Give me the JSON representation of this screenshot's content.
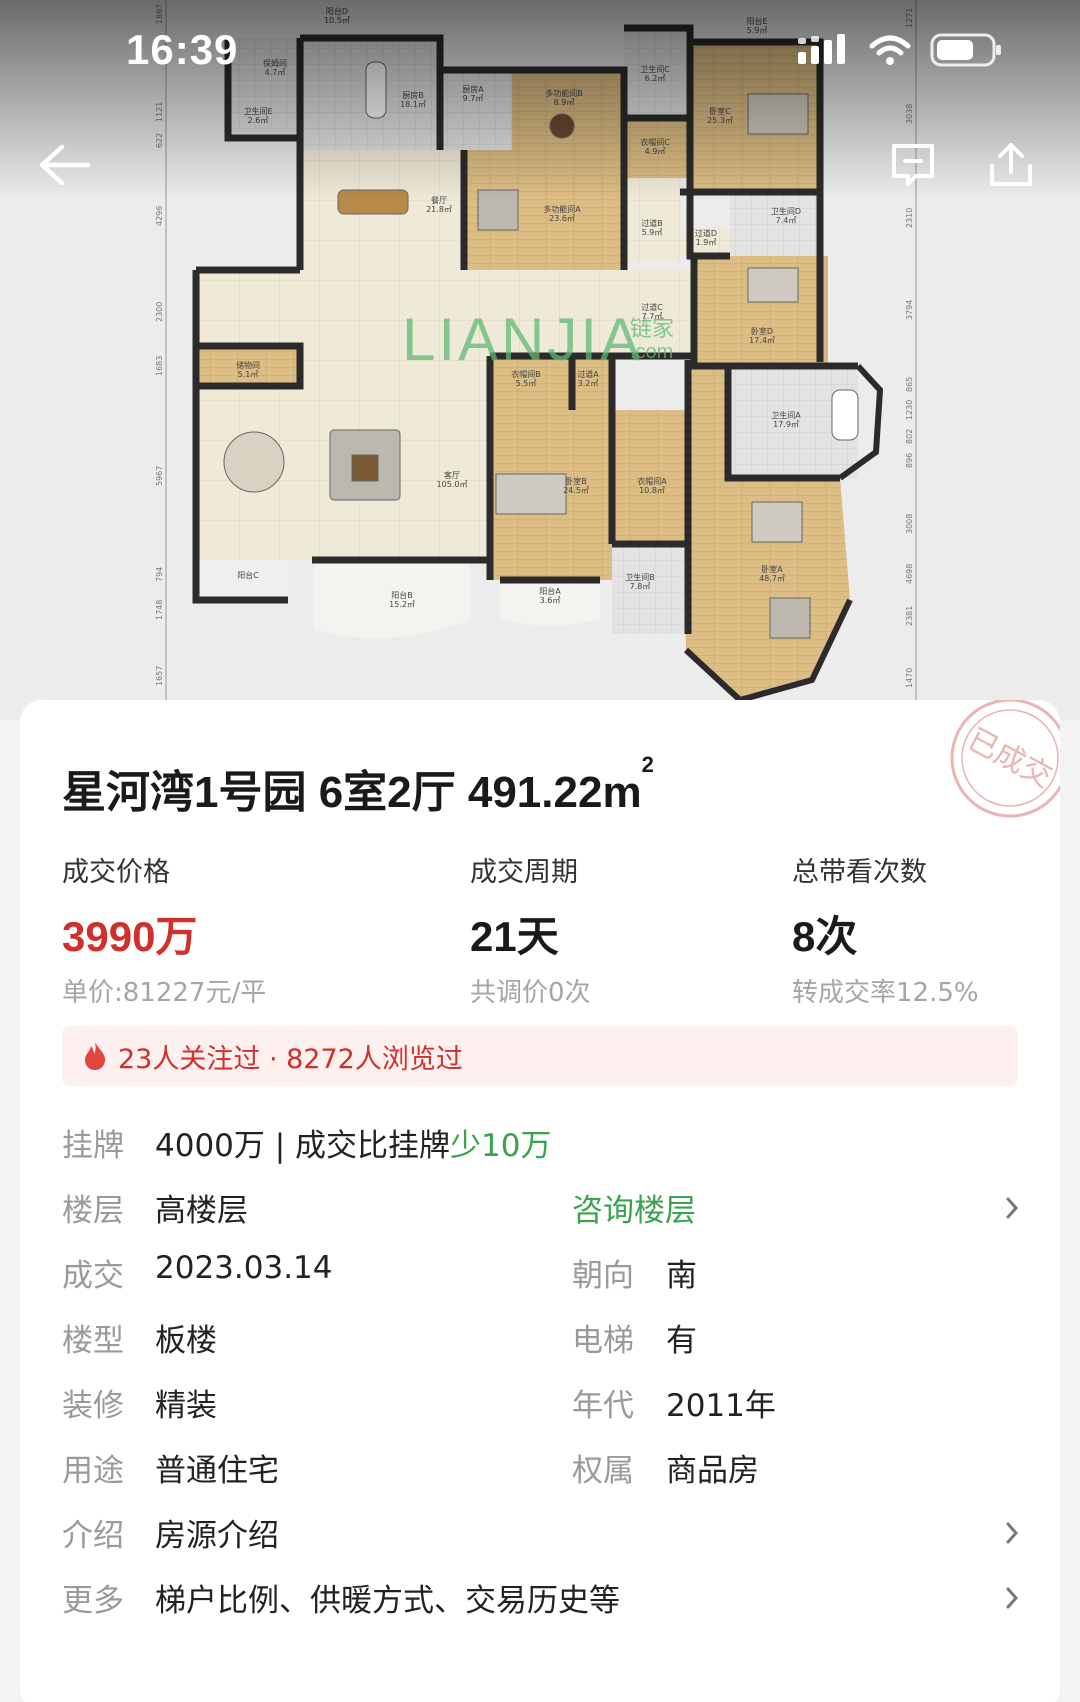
{
  "status": {
    "time": "16:39"
  },
  "floorplan": {
    "watermark_logo": "LIANJIA",
    "watermark_cn": "链家",
    "watermark_domain": ".com",
    "rooms": [
      {
        "name": "阳台D",
        "area": "10.5㎡"
      },
      {
        "name": "保姆间",
        "area": "4.7㎡"
      },
      {
        "name": "卫生间E",
        "area": "2.6㎡"
      },
      {
        "name": "厨房B",
        "area": "18.1㎡"
      },
      {
        "name": "厨房A",
        "area": "9.7㎡"
      },
      {
        "name": "多功能间B",
        "area": "8.9㎡"
      },
      {
        "name": "卫生间C",
        "area": "6.2㎡"
      },
      {
        "name": "阳台E",
        "area": "5.9㎡"
      },
      {
        "name": "卧室C",
        "area": "25.3㎡"
      },
      {
        "name": "衣帽间C",
        "area": "4.9㎡"
      },
      {
        "name": "餐厅",
        "area": "21.8㎡"
      },
      {
        "name": "多功能间A",
        "area": "23.6㎡"
      },
      {
        "name": "过道B",
        "area": "5.9㎡"
      },
      {
        "name": "过道D",
        "area": "1.9㎡"
      },
      {
        "name": "卫生间D",
        "area": "7.4㎡"
      },
      {
        "name": "卧室D",
        "area": "17.4㎡"
      },
      {
        "name": "过道C",
        "area": "7.7㎡"
      },
      {
        "name": "储物间",
        "area": "5.1㎡"
      },
      {
        "name": "衣帽间B",
        "area": "5.5㎡"
      },
      {
        "name": "过道A",
        "area": "3.2㎡"
      },
      {
        "name": "卫生间A",
        "area": "17.9㎡"
      },
      {
        "name": "客厅",
        "area": "105.0㎡"
      },
      {
        "name": "卧室B",
        "area": "24.5㎡"
      },
      {
        "name": "衣帽间A",
        "area": "10.8㎡"
      },
      {
        "name": "卧室A",
        "area": "48.7㎡"
      },
      {
        "name": "阳台C",
        "area": ""
      },
      {
        "name": "阳台B",
        "area": "15.2㎡"
      },
      {
        "name": "阳台A",
        "area": "3.6㎡"
      },
      {
        "name": "卫生间B",
        "area": "7.8㎡"
      }
    ],
    "dimensions_left": [
      "1867",
      "1121",
      "622",
      "4296",
      "2300",
      "1683",
      "5967",
      "794",
      "1748",
      "1657"
    ],
    "dimensions_right": [
      "1271",
      "3038",
      "2310",
      "3794",
      "865",
      "1230",
      "802",
      "896",
      "3008",
      "4698",
      "2381",
      "1470"
    ]
  },
  "listing": {
    "title": "星河湾1号园 6室2厅 491.22m",
    "title_sup": "2",
    "stamp": "已成交",
    "stats": [
      {
        "label": "成交价格",
        "value": "3990万",
        "sub": "单价:81227元/平"
      },
      {
        "label": "成交周期",
        "value": "21天",
        "sub": "共调价0次"
      },
      {
        "label": "总带看次数",
        "value": "8次",
        "sub": "转成交率12.5%"
      }
    ],
    "hot_text": "23人关注过 · 8272人浏览过",
    "listing_label": "挂牌",
    "listing_value": "4000万 | 成交比挂牌",
    "listing_diff": "少10万",
    "floor": {
      "k": "楼层",
      "v": "高楼层",
      "link": "咨询楼层"
    },
    "deal": {
      "k": "成交",
      "v": "2023.03.14",
      "k2": "朝向",
      "v2": "南"
    },
    "type": {
      "k": "楼型",
      "v": "板楼",
      "k2": "电梯",
      "v2": "有"
    },
    "deco": {
      "k": "装修",
      "v": "精装",
      "k2": "年代",
      "v2": "2011年"
    },
    "usage": {
      "k": "用途",
      "v": "普通住宅",
      "k2": "权属",
      "v2": "商品房"
    },
    "intro": {
      "k": "介绍",
      "v": "房源介绍"
    },
    "more": {
      "k": "更多",
      "v": "梯户比例、供暖方式、交易历史等"
    }
  },
  "colors": {
    "accent_red": "#d0302b",
    "accent_green": "#3aa34f",
    "floor_wood": "#d9b97f",
    "floor_tile": "#ece6d6"
  }
}
